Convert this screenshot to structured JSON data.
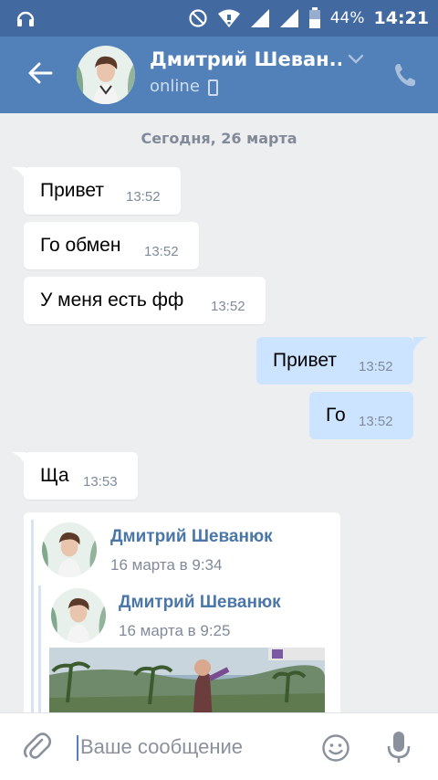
{
  "status_bar": {
    "battery_percent": "44%",
    "time": "14:21",
    "icons": [
      "headset-icon",
      "do-not-disturb-icon",
      "wifi-icon",
      "signal-icon",
      "signal-icon",
      "battery-icon"
    ]
  },
  "header": {
    "name": "Дмитрий Шеван...",
    "status": "online",
    "icons": [
      "back-arrow-icon",
      "chevron-down-icon",
      "mobile-phone-icon",
      "phone-call-icon"
    ]
  },
  "chat": {
    "date_separator": "Сегодня, 26 марта",
    "messages": [
      {
        "direction": "in",
        "text": "Привет",
        "time": "13:52"
      },
      {
        "direction": "in",
        "text": "Го обмен",
        "time": "13:52"
      },
      {
        "direction": "in",
        "text": "У меня есть фф",
        "time": "13:52"
      },
      {
        "direction": "out",
        "text": "Привет",
        "time": "13:52"
      },
      {
        "direction": "out",
        "text": "Го",
        "time": "13:52"
      },
      {
        "direction": "in",
        "text": "Ща",
        "time": "13:53"
      }
    ],
    "forwarded": {
      "outer": {
        "author": "Дмитрий Шеванюк",
        "date": "16 марта в 9:34"
      },
      "inner": {
        "author": "Дмитрий Шеванюк",
        "date": "16 марта в 9:25"
      }
    }
  },
  "composer": {
    "placeholder": "Ваше сообщение",
    "value": "",
    "icons": [
      "attach-paperclip-icon",
      "emoji-icon",
      "microphone-icon"
    ]
  },
  "colors": {
    "status_bar": "#426aa0",
    "header": "#5181b8",
    "background": "#edeef0",
    "incoming_bubble": "#ffffff",
    "outgoing_bubble": "#cce4ff",
    "link": "#4a76a8"
  }
}
